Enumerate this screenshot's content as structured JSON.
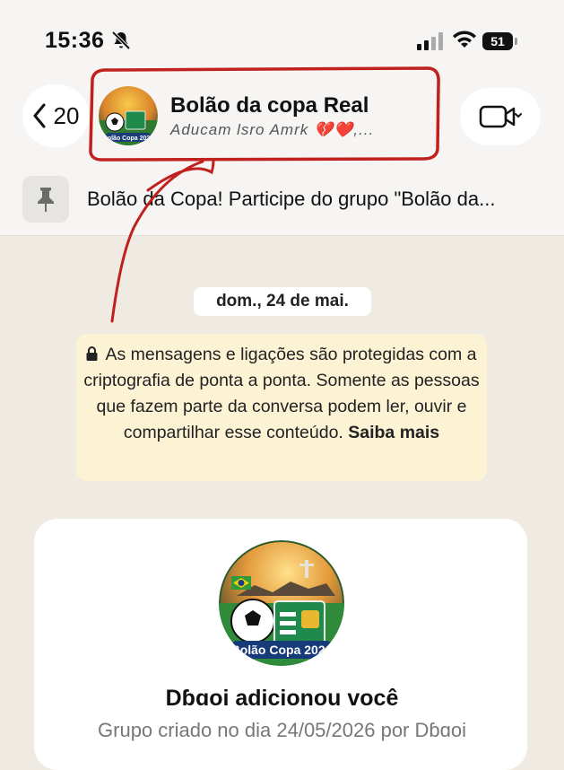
{
  "status_bar": {
    "time": "15:36",
    "battery": "51",
    "icons": [
      "bell-slash-icon",
      "signal-icon",
      "wifi-icon",
      "battery-icon"
    ]
  },
  "header": {
    "back_count": "20",
    "group_name": "Bolão da copa Real",
    "subtitle": "Aducam lsro Amrk 💔❤️,...",
    "avatar_caption": "Bolão Copa 2026",
    "video_icon": "video-camera-icon"
  },
  "pinned": {
    "text": "Bolão da Copa! Participe do grupo \"Bolão da..."
  },
  "chat": {
    "date": "dom., 24 de mai.",
    "encryption_notice": "As mensagens e ligações são protegidas com a criptografia de ponta a ponta. Somente as pessoas que fazem parte da conversa podem ler, ouvir e compartilhar esse conteúdo.",
    "encryption_more": "Saiba mais"
  },
  "card": {
    "avatar_caption": "Bolão Copa 2026",
    "title": "Dɓɑoi adicionou você",
    "subtitle": "Grupo criado no dia 24/05/2026 por Dɓɑoi"
  },
  "colors": {
    "annotation": "#c0201e",
    "encryption_bg": "#fcf2d4",
    "wallpaper": "#efeae2"
  }
}
